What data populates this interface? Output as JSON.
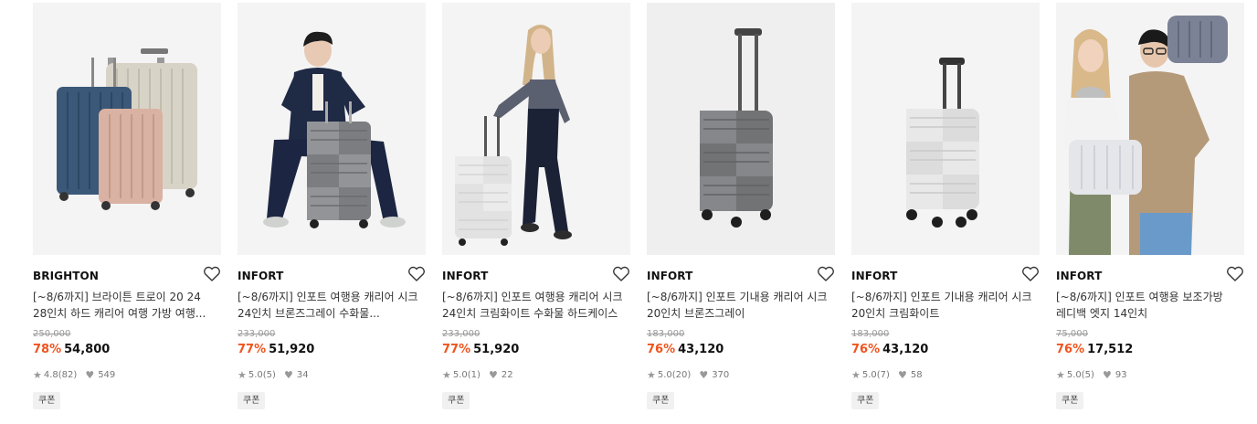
{
  "products": [
    {
      "brand": "BRIGHTON",
      "title_line1": "[~8/6까지] 브라이튼 트로이 20 24",
      "title_line2": "28인치 하드 캐리어 여행 가방 여행...",
      "original_price": "250,000",
      "discount": "78%",
      "price": "54,800",
      "rating": "4.8",
      "reviews": "(82)",
      "likes": "549",
      "badge": "쿠폰",
      "image": "three-hard-suitcases-navy-beige-rosegold"
    },
    {
      "brand": "INFORT",
      "title_line1": "[~8/6까지] 인포트 여행용 캐리어 시크",
      "title_line2": "24인치 브론즈그레이 수화물...",
      "original_price": "233,000",
      "discount": "77%",
      "price": "51,920",
      "rating": "5.0",
      "reviews": "(5)",
      "likes": "34",
      "badge": "쿠폰",
      "image": "man-sitting-on-grey-suitcase"
    },
    {
      "brand": "INFORT",
      "title_line1": "[~8/6까지] 인포트 여행용 캐리어 시크",
      "title_line2": "24인치 크림화이트 수화물 하드케이스",
      "original_price": "233,000",
      "discount": "77%",
      "price": "51,920",
      "rating": "5.0",
      "reviews": "(1)",
      "likes": "22",
      "badge": "쿠폰",
      "image": "woman-with-white-suitcase"
    },
    {
      "brand": "INFORT",
      "title_line1": "[~8/6까지] 인포트 기내용 캐리어 시크",
      "title_line2": "20인치 브론즈그레이",
      "original_price": "183,000",
      "discount": "76%",
      "price": "43,120",
      "rating": "5.0",
      "reviews": "(20)",
      "likes": "370",
      "badge": "쿠폰",
      "image": "grey-cabin-suitcase"
    },
    {
      "brand": "INFORT",
      "title_line1": "[~8/6까지] 인포트 기내용 캐리어 시크",
      "title_line2": "20인치 크림화이트",
      "original_price": "183,000",
      "discount": "76%",
      "price": "43,120",
      "rating": "5.0",
      "reviews": "(7)",
      "likes": "58",
      "badge": "쿠폰",
      "image": "white-cabin-suitcase"
    },
    {
      "brand": "INFORT",
      "title_line1": "[~8/6까지] 인포트 여행용 보조가방",
      "title_line2": "레디백 엣지 14인치",
      "original_price": "75,000",
      "discount": "76%",
      "price": "17,512",
      "rating": "5.0",
      "reviews": "(5)",
      "likes": "93",
      "badge": "쿠폰",
      "image": "couple-with-vanity-cases"
    }
  ],
  "icons": {
    "wishlist": "heart-outline-icon",
    "rating": "star-icon",
    "likes": "heart-filled-icon"
  },
  "colors": {
    "discount": "#f0541e",
    "text": "#111111",
    "muted": "#999999"
  }
}
